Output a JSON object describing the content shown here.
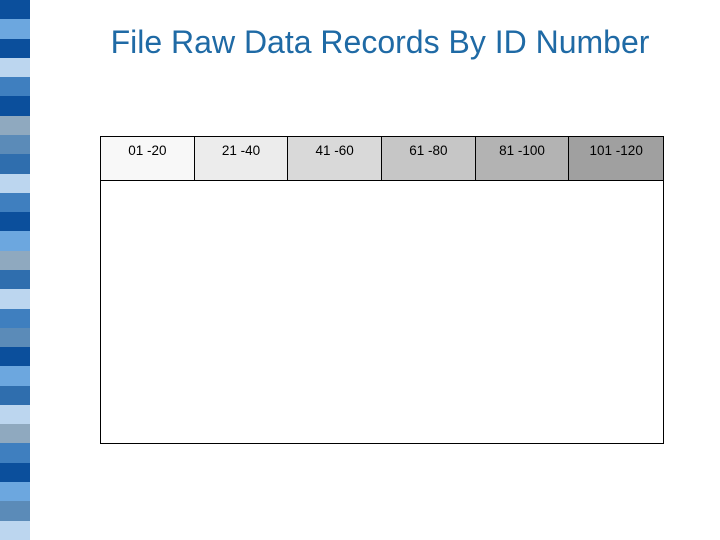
{
  "title": "File Raw Data Records By ID Number",
  "tabs": [
    {
      "label": "01 -20",
      "bg": "#f8f8f8"
    },
    {
      "label": "21 -40",
      "bg": "#ececec"
    },
    {
      "label": "41 -60",
      "bg": "#d9d9d9"
    },
    {
      "label": "61 -80",
      "bg": "#c6c6c6"
    },
    {
      "label": "81 -100",
      "bg": "#b3b3b3"
    },
    {
      "label": "101 -120",
      "bg": "#a0a0a0"
    }
  ],
  "stripe_colors": [
    "#0b4f9c",
    "#6ca7df",
    "#0b4f9c",
    "#bcd6ef",
    "#3f7fbf",
    "#0b4f9c",
    "#8fa9bf",
    "#5b8bb8",
    "#2f6eae",
    "#bcd6ef",
    "#3f7fbf",
    "#0b4f9c",
    "#6ca7df",
    "#8fa9bf",
    "#2f6eae",
    "#bcd6ef",
    "#3f7fbf",
    "#5b8bb8",
    "#0b4f9c",
    "#6ca7df",
    "#2f6eae",
    "#bcd6ef",
    "#8fa9bf",
    "#3f7fbf",
    "#0b4f9c",
    "#6ca7df",
    "#5b8bb8",
    "#bcd6ef"
  ]
}
